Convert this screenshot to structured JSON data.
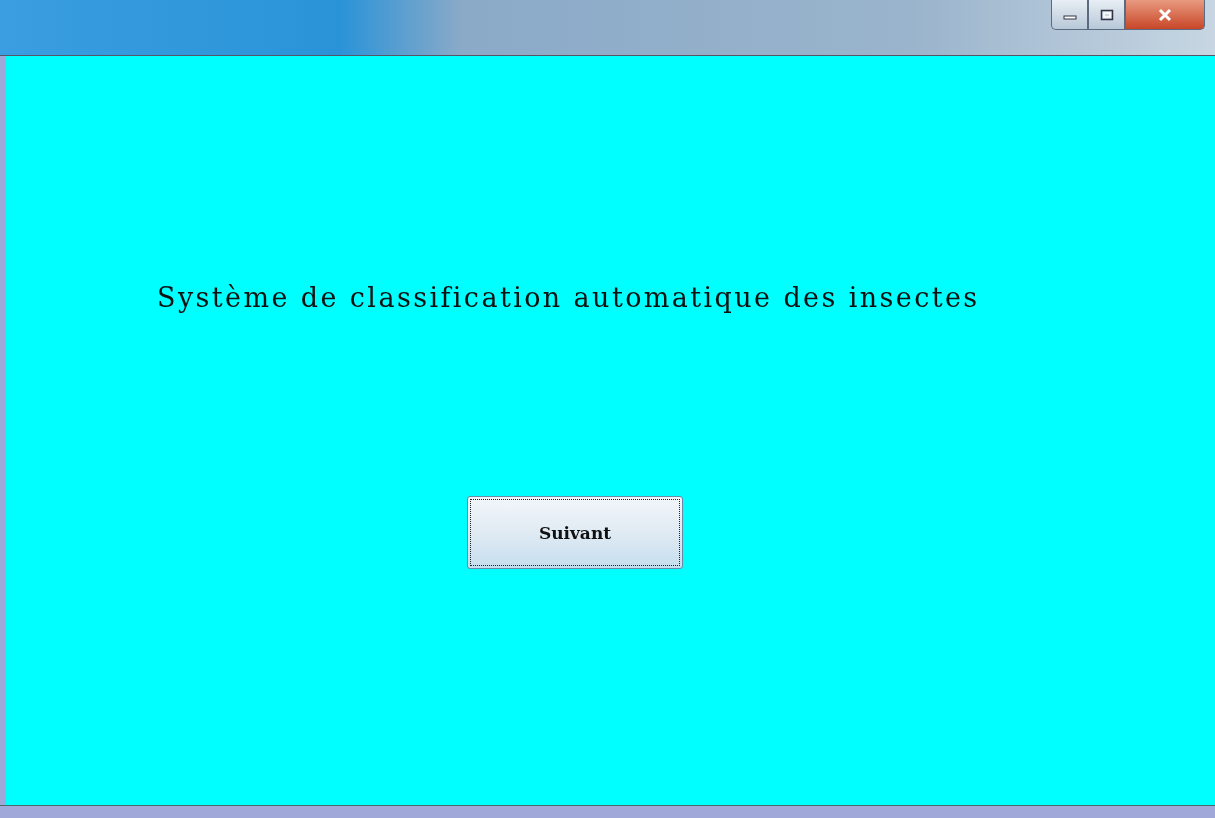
{
  "window": {
    "controls": [
      {
        "kind": "minimize"
      },
      {
        "kind": "maximize"
      },
      {
        "kind": "close"
      }
    ]
  },
  "heading": "Système de classification automatique des insectes",
  "button": {
    "label": "Suivant",
    "focused": true
  }
}
